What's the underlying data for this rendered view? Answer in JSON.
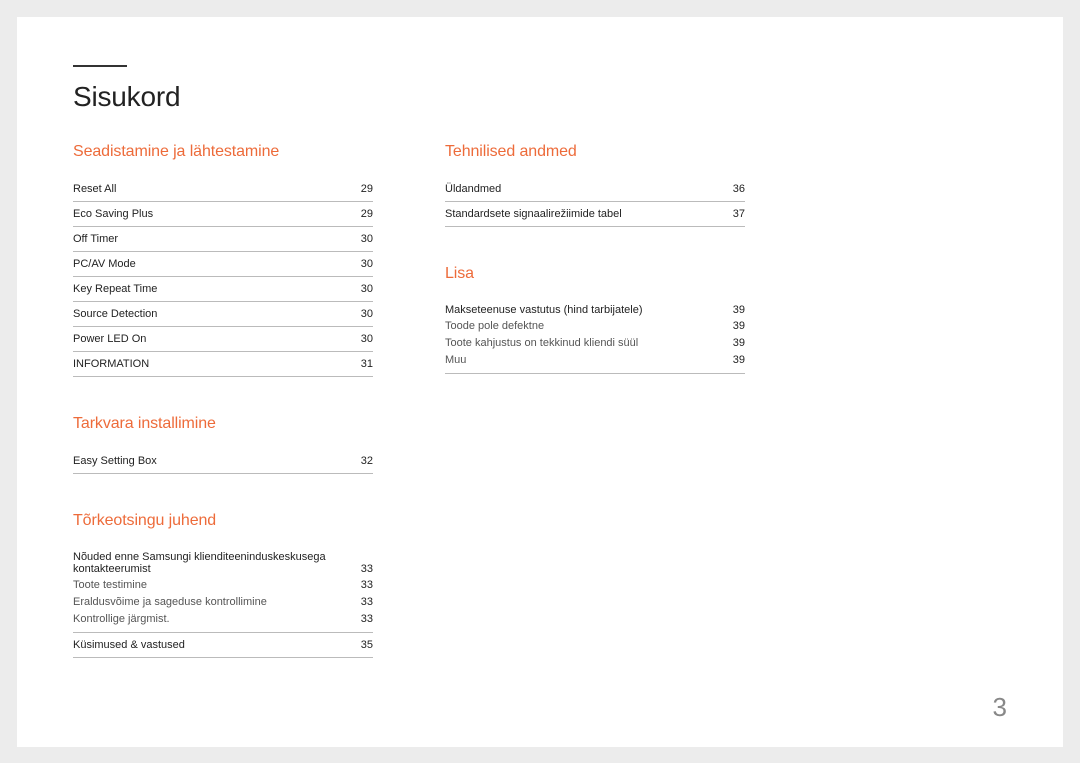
{
  "title": "Sisukord",
  "page_number": "3",
  "columns": [
    {
      "sections": [
        {
          "heading": "Seadistamine ja lähtestamine",
          "entries": [
            {
              "label": "Reset All",
              "page": "29",
              "bordered": true
            },
            {
              "label": "Eco Saving Plus",
              "page": "29",
              "bordered": true
            },
            {
              "label": "Off Timer",
              "page": "30",
              "bordered": true
            },
            {
              "label": "PC/AV Mode",
              "page": "30",
              "bordered": true
            },
            {
              "label": "Key Repeat Time",
              "page": "30",
              "bordered": true
            },
            {
              "label": "Source Detection",
              "page": "30",
              "bordered": true
            },
            {
              "label": "Power LED On",
              "page": "30",
              "bordered": true
            },
            {
              "label": "INFORMATION",
              "page": "31",
              "bordered": true
            }
          ]
        },
        {
          "heading": "Tarkvara installimine",
          "entries": [
            {
              "label": "Easy Setting Box",
              "page": "32",
              "bordered": true
            }
          ]
        },
        {
          "heading": "Tõrkeotsingu juhend",
          "entries": [
            {
              "label": "Nõuded enne Samsungi klienditeeninduskeskusega kontakteerumist",
              "page": "33",
              "bordered": true,
              "sub": [
                {
                  "label": "Toote testimine",
                  "page": "33"
                },
                {
                  "label": "Eraldusvõime ja sageduse kontrollimine",
                  "page": "33"
                },
                {
                  "label": "Kontrollige järgmist.",
                  "page": "33"
                }
              ]
            },
            {
              "label": "Küsimused & vastused",
              "page": "35",
              "bordered": true
            }
          ]
        }
      ]
    },
    {
      "sections": [
        {
          "heading": "Tehnilised andmed",
          "entries": [
            {
              "label": "Üldandmed",
              "page": "36",
              "bordered": true
            },
            {
              "label": "Standardsete signaalirežiimide tabel",
              "page": "37",
              "bordered": true
            }
          ]
        },
        {
          "heading": "Lisa",
          "entries": [
            {
              "label": "Makseteenuse vastutus (hind tarbijatele)",
              "page": "39",
              "bordered": true,
              "sub": [
                {
                  "label": "Toode pole defektne",
                  "page": "39"
                },
                {
                  "label": "Toote kahjustus on tekkinud kliendi süül",
                  "page": "39"
                },
                {
                  "label": "Muu",
                  "page": "39"
                }
              ]
            }
          ]
        }
      ]
    }
  ]
}
